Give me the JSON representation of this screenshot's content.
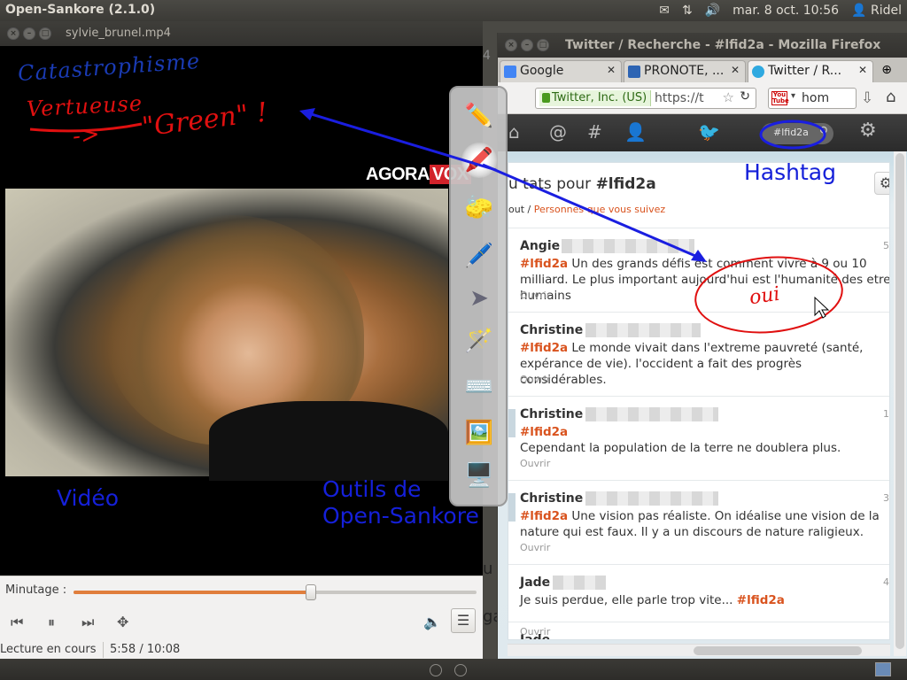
{
  "top_panel": {
    "app_title": "Open-Sankore (2.1.0)",
    "datetime": "mar. 8 oct. 10:56",
    "user": "Ridel"
  },
  "player": {
    "window_title": "sylvie_brunel.mp4",
    "logo": "AGORA VOX",
    "time_label": "Minutage :",
    "status": "Lecture en cours",
    "position": "5:58 / 10:08",
    "progress": 0.589,
    "icons": [
      "skip-back-icon",
      "pause-icon",
      "skip-forward-icon",
      "move-icon",
      "volume-icon",
      "menu-icon"
    ]
  },
  "firefox": {
    "window_title": "Twitter / Recherche - #lfid2a - Mozilla Firefox",
    "tabs": [
      {
        "label": "Google",
        "favicon_color": "#4285f4"
      },
      {
        "label": "PRONOTE, ...",
        "favicon_color": "#2d64b3"
      },
      {
        "label": "Twitter / R...",
        "favicon_color": "#2fa9e0"
      }
    ],
    "url_site": "Twitter, Inc. (US)",
    "url": "https://t",
    "search_value": "hom",
    "search_engine": "You Tube"
  },
  "twitter": {
    "search_value": "#lfid2a",
    "heading_prefix": "u tats pour",
    "heading_tag": "#lfid2a",
    "filter_all": "out",
    "filter_sep": " / ",
    "filter_following": "Personnes que vous suivez",
    "open_label": "Ouvrir",
    "tweets": [
      {
        "author": "Angie",
        "tag": "#lfid2a",
        "text": " Un des grands défis est comment vivre à 9 ou 10 milliard. Le plus important aujourd'hui est l'humanité des etre humains",
        "time": "5"
      },
      {
        "author": "Christine",
        "tag": "#lfid2a",
        "text": " Le monde vivait dans l'extreme pauvreté (santé, expérance de vie). l'occident a fait des progrès considérables.",
        "time": ""
      },
      {
        "author": "Christine",
        "tag": "#lfid2a",
        "text": "Cependant la population de la terre ne doublera plus.",
        "time": "1"
      },
      {
        "author": "Christine",
        "tag": "#lfid2a",
        "text": " Une vision pas réaliste. On idéalise une vision de la nature qui est faux. Il y a un discours de nature raligieux.",
        "time": "3"
      },
      {
        "author": "Jade",
        "tag": "#lfid2a",
        "text": "Je suis perdue, elle parle trop vite... ",
        "time": "4"
      },
      {
        "author": "Jade",
        "tag": "",
        "text": "",
        "time": ""
      }
    ]
  },
  "behind_window": {
    "c1": "4",
    "c2": "u",
    "c3": "ga"
  },
  "annotations": {
    "hashtag": "Hashtag",
    "video": "Vidéo",
    "tools_line1": "Outils de",
    "tools_line2": "Open-Sankore",
    "handwriting_line1": "Catastrophisme",
    "handwriting_line2": "Vertueuse",
    "handwriting_line3": "\"Green\" !",
    "handwriting_line4": "-> ",
    "handwriting_tweet": "oui",
    "ink_red": "#e01010",
    "ink_blue": "#1a3bb4",
    "arrow_blue": "#1a1ee0"
  },
  "sankore_tools": [
    "pen-tool-icon",
    "marker-tool-icon",
    "eraser-tool-icon",
    "highlighter-tool-icon",
    "pointer-tool-icon",
    "laser-pointer-icon",
    "keyboard-icon",
    "capture-icon",
    "desktop-icon"
  ]
}
